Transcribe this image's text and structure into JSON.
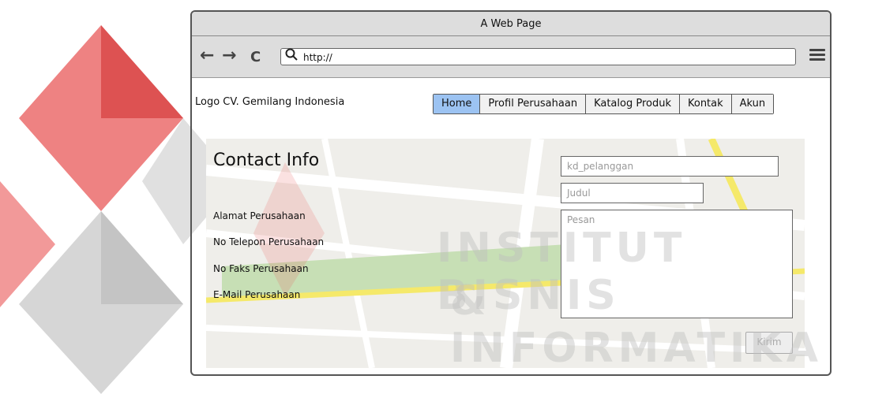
{
  "window": {
    "title": "A Web Page"
  },
  "toolbar": {
    "back_icon": "←",
    "forward_icon": "→",
    "reload_icon": "C",
    "url": "http://"
  },
  "header": {
    "logo_text": "Logo CV. Gemilang Indonesia"
  },
  "nav": {
    "items": [
      {
        "label": "Home",
        "active": true
      },
      {
        "label": "Profil Perusahaan",
        "active": false
      },
      {
        "label": "Katalog Produk",
        "active": false
      },
      {
        "label": "Kontak",
        "active": false
      },
      {
        "label": "Akun",
        "active": false
      }
    ]
  },
  "contact": {
    "title": "Contact Info",
    "items": [
      "Alamat Perusahaan",
      "No Telepon Perusahaan",
      "No Faks Perusahaan",
      "E-Mail Perusahaan"
    ]
  },
  "form": {
    "kd_placeholder": "kd_pelanggan",
    "judul_placeholder": "Judul",
    "pesan_placeholder": "Pesan",
    "submit_label": "Kirim"
  },
  "watermark": {
    "line1": "INSTITUT BISNIS",
    "line2": "& INFORMATIKA"
  },
  "colors": {
    "active_tab": "#9cc3f2",
    "chrome": "#dddddd",
    "map_bg": "#efeeea",
    "map_park": "#c7dfb5",
    "map_road_yellow": "#f5e96a",
    "watermark_red": "#e85a5a"
  }
}
